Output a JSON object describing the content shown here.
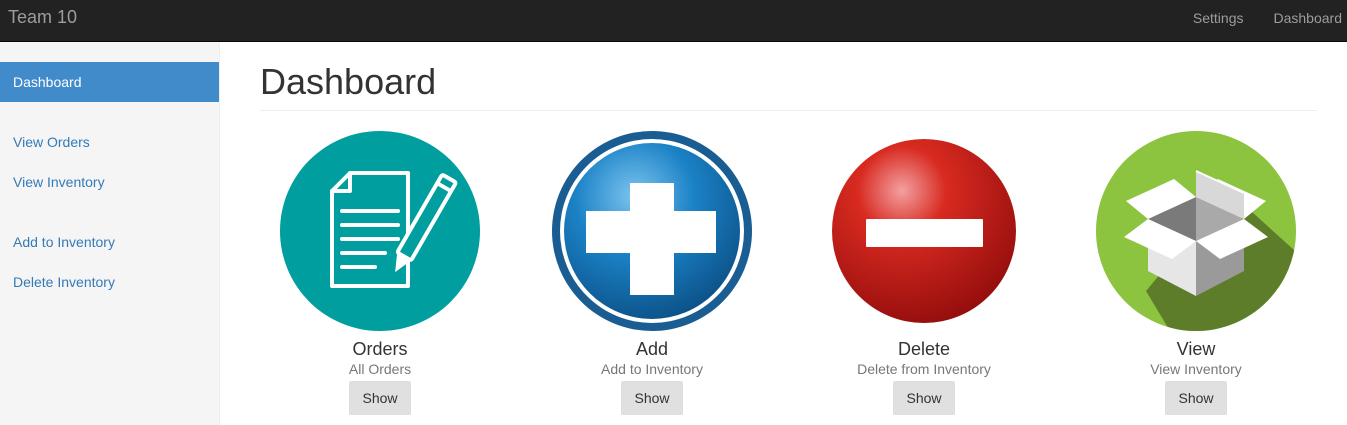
{
  "navbar": {
    "brand": "Team 10",
    "links": [
      {
        "label": "Settings"
      },
      {
        "label": "Dashboard"
      }
    ]
  },
  "sidebar": {
    "groups": [
      [
        {
          "label": "Dashboard",
          "active": true
        }
      ],
      [
        {
          "label": "View Orders"
        },
        {
          "label": "View Inventory"
        }
      ],
      [
        {
          "label": "Add to Inventory"
        },
        {
          "label": "Delete Inventory"
        }
      ]
    ]
  },
  "main": {
    "title": "Dashboard",
    "tiles": [
      {
        "title": "Orders",
        "subtitle": "All Orders",
        "button": "Show",
        "icon": "document-pencil-icon",
        "color": "#009e9e"
      },
      {
        "title": "Add",
        "subtitle": "Add to Inventory",
        "button": "Show",
        "icon": "plus-icon",
        "color": "#1a6fa8"
      },
      {
        "title": "Delete",
        "subtitle": "Delete from Inventory",
        "button": "Show",
        "icon": "minus-icon",
        "color": "#c4150f"
      },
      {
        "title": "View",
        "subtitle": "View Inventory",
        "button": "Show",
        "icon": "box-icon",
        "color": "#8cc43f"
      }
    ]
  }
}
